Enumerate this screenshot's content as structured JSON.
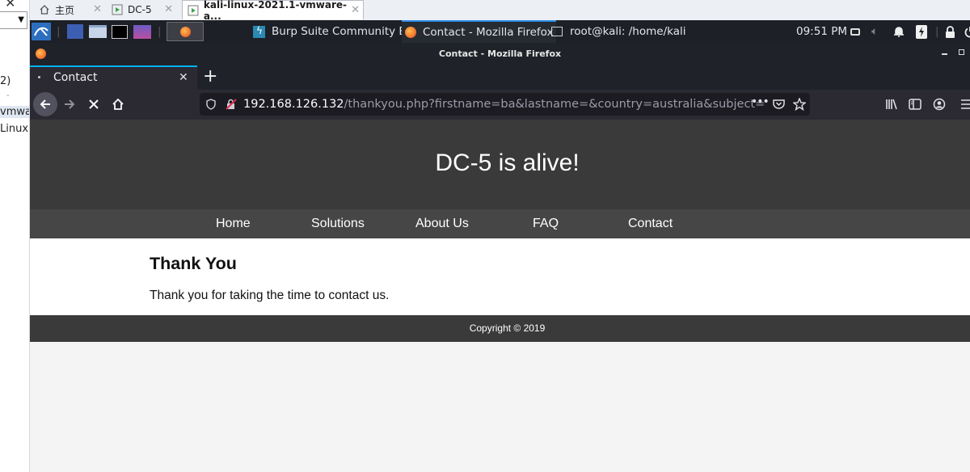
{
  "vmware": {
    "tabs": [
      {
        "label": "主页"
      },
      {
        "label": "DC-5"
      },
      {
        "label": "kali-linux-2021.1-vmware-a..."
      }
    ],
    "left_fragments": [
      "2)",
      "vmwa",
      "Linux"
    ]
  },
  "kali_panel": {
    "tasks": [
      {
        "label": "Burp Suite Community E..."
      },
      {
        "label": "Contact - Mozilla Firefox"
      },
      {
        "label": "root@kali: /home/kali"
      }
    ],
    "clock": "09:51 PM"
  },
  "firefox": {
    "window_title": "Contact - Mozilla Firefox",
    "tab_title": "Contact",
    "url_host": "192.168.126.132",
    "url_path": "/thankyou.php?firstname=ba&lastname=&country=australia&subject="
  },
  "site": {
    "heading": "DC-5 is alive!",
    "nav": [
      {
        "label": "Home"
      },
      {
        "label": "Solutions"
      },
      {
        "label": "About Us"
      },
      {
        "label": "FAQ"
      },
      {
        "label": "Contact"
      }
    ],
    "title": "Thank You",
    "message": "Thank you for taking the time to contact us.",
    "copyright": "Copyright © 2019"
  }
}
